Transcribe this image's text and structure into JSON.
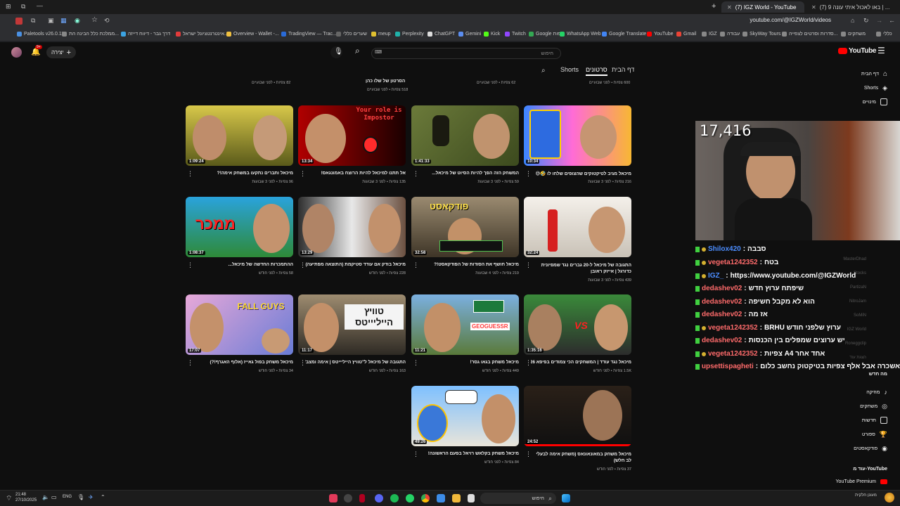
{
  "browser": {
    "tabs": [
      {
        "label": "(7) IGZ World - YouTube",
        "active": true
      },
      {
        "label": "(7) באו לאכול איתי עונה 9 | ...",
        "active": false
      }
    ],
    "url": "youtube.com/@IGZWorld/videos",
    "bookmarks": [
      "Paletools v26.0.11",
      "ממלכת כלל הבינה הת...",
      "דרך גבר - דיווח דייזה",
      "אינטרנטציונל ישראל...",
      "Overview - Wallet -...",
      "TradingView — Trac...",
      "שערים כללי",
      "meup",
      "Perplexity",
      "ChatGPT",
      "Gemini",
      "Kick",
      "Twitch",
      "Google מפות",
      "WhatsApp Web",
      "Google Translate",
      "YouTube",
      "Gmail",
      "IGZ",
      "עבודה",
      "SkyWay Tours",
      "סדרות וסרטים לצפייה...",
      "משחקים",
      "כללי"
    ]
  },
  "youtube": {
    "logo": "YouTube",
    "search_placeholder": "חיפוש",
    "create_label": "יצירה",
    "notification_count": "9+",
    "channel_tabs": [
      "דף הבית",
      "סרטונים",
      "Shorts"
    ],
    "active_tab": "סרטונים"
  },
  "prev_row_meta": [
    "600 צפיות • לפני שבועיים",
    "62 צפיות • לפני שבועיים",
    "518 צפיות • לפני שבועיים",
    "82 צפיות • לפני שבועיים"
  ],
  "prev_row_title": "הסרטון של שלו כהן",
  "videos": [
    {
      "duration": "10:34",
      "title": "מיכאל מגיב לטיקטוקים שהצופים שלחו לו 🤣😅",
      "meta": "216 צפיות • לפני 3 שבועות",
      "thumb_text": ""
    },
    {
      "duration": "1:41:33",
      "title": "המשחק הזה הפך להיות הסיוט של מיכאל...",
      "meta": "59 צפיות • לפני 3 שבועות",
      "thumb_text": ""
    },
    {
      "duration": "13:34",
      "title": "אל תתנו למיכאל להיות הרוצח באמונגאס!",
      "meta": "135 צפיות • לפני 3 שבועות",
      "thumb_text": "Your role is Impostor"
    },
    {
      "duration": "1:09:24",
      "title": "מיכאל ותברים נתקעו במשחק אימה!?",
      "meta": "96 צפיות • לפני 3 שבועות",
      "thumb_text": ""
    },
    {
      "duration": "32:24",
      "title": "התגובה של מיכאל ל-20 גברים נגד שמפיונית כדורגל | אייזק ראובן",
      "meta": "439 צפיות • לפני 3 שבועות",
      "thumb_text": ""
    },
    {
      "duration": "32:58",
      "title": "מיכאל חושף את הסודות של הפודקאסט!?",
      "meta": "219 צפיות • לפני 4 שבועות",
      "thumb_text": "פודקאסט"
    },
    {
      "duration": "13:29",
      "title": "מיכאל בודק אם עודד סטיקמת (התוצאה מפתיעה)",
      "meta": "228 צפיות • לפני חודש",
      "thumb_text": ""
    },
    {
      "duration": "1:08:37",
      "title": "ההתמכרות החדשה של מיכאל...",
      "meta": "58 צפיות • לפני חודש",
      "thumb_text": "ממכר"
    },
    {
      "duration": "1:35:16",
      "title": "מיכאל נגד עודד | המשחקים הכי צמודים בפיפא 26!",
      "meta": "1.5K צפיות • לפני חודש",
      "thumb_text": "VS"
    },
    {
      "duration": "11:21",
      "title": "מיכאל משחק בגאו גסר!",
      "meta": "449 צפיות • לפני חודש",
      "thumb_text": "GEOGUESSR"
    },
    {
      "duration": "11:17",
      "title": "התגובה של מיכאל ל\"טוויץ הייליייטס | אימה ומצב\"",
      "meta": "163 צפיות • לפני חודש",
      "thumb_text": "טוויץ הייליייטס"
    },
    {
      "duration": "17:07",
      "title": "מיכאל משחק בפול גאייז (אלוף האגרף!?)",
      "meta": "34 צפיות • לפני חודש",
      "thumb_text": "FALL GUYS"
    },
    {
      "duration": "24:52",
      "title": "מיכאל משחק במאונאונאס (משחק אימה לבעלי לב חלש)",
      "meta": "37 צפיות • לפני חודש",
      "thumb_text": ""
    },
    {
      "duration": "49:26",
      "title": "מיכאל משחק בקלאש רויאל בפעם הראשונה!",
      "meta": "84 צפיות • לפני חודש",
      "thumb_text": ""
    }
  ],
  "sidebar": {
    "items": [
      "דף הבית",
      "Shorts",
      "מינויים"
    ],
    "explore_header": "מה חדש",
    "explore_items": [
      "מוזיקה",
      "משחקים",
      "חדשות",
      "ספורט",
      "פודקאסטים"
    ],
    "more_header": "עוד מ-YouTube",
    "premium": "YouTube Premium"
  },
  "stream": {
    "viewer_count": "17,416"
  },
  "chat": [
    {
      "user": "Shilox420",
      "message": "סבבה",
      "user_color": "#4c8dff"
    },
    {
      "user": "vegeta1242352",
      "message": "בטח",
      "user_color": "#ff6b6b"
    },
    {
      "user": "IGZ_",
      "message": "https://www.youtube.com/@IGZWorld",
      "user_color": "#4c8dff"
    },
    {
      "user": "dedashev02",
      "message": "שיפתח ערוץ חדש",
      "user_color": "#ff6b6b"
    },
    {
      "user": "dedashev02",
      "message": "הוא לא מקבל חשיפה",
      "user_color": "#ff6b6b"
    },
    {
      "user": "dedashev02",
      "message": "אז מה",
      "user_color": "#ff6b6b"
    },
    {
      "user": "vegeta1242352",
      "message": "BRHU ערוץ שלפני חודש",
      "user_color": "#ff6b6b"
    },
    {
      "user": "dedashev02",
      "message": "יש ערוצים שמפלים בין הכנסות",
      "user_color": "#ff6b6b"
    },
    {
      "user": "vegeta1242352",
      "message": "צפיות Aאחד אחר 4",
      "user_color": "#ff6b6b"
    },
    {
      "user": "upsettispagheti",
      "message": "אשכרה אבל אלף צפיות בטיקטוק נחשב כלום",
      "user_color": "#ff6b6b"
    }
  ],
  "subs_ghost": [
    "MasterDhad",
    "Stocks",
    "PartizaN",
    "NitroJam",
    "SoMiN",
    "IGZ World",
    "Roneggclip",
    "הצגת עוד"
  ],
  "taskbar": {
    "time": "21:48",
    "date": "27/10/2025",
    "lang": "ENG",
    "search": "חיפוש",
    "weather": "מעונן חלקית"
  },
  "colors": {
    "youtube_red": "#ff0000",
    "background": "#0f0f0f",
    "chat_green": "#40d040"
  }
}
